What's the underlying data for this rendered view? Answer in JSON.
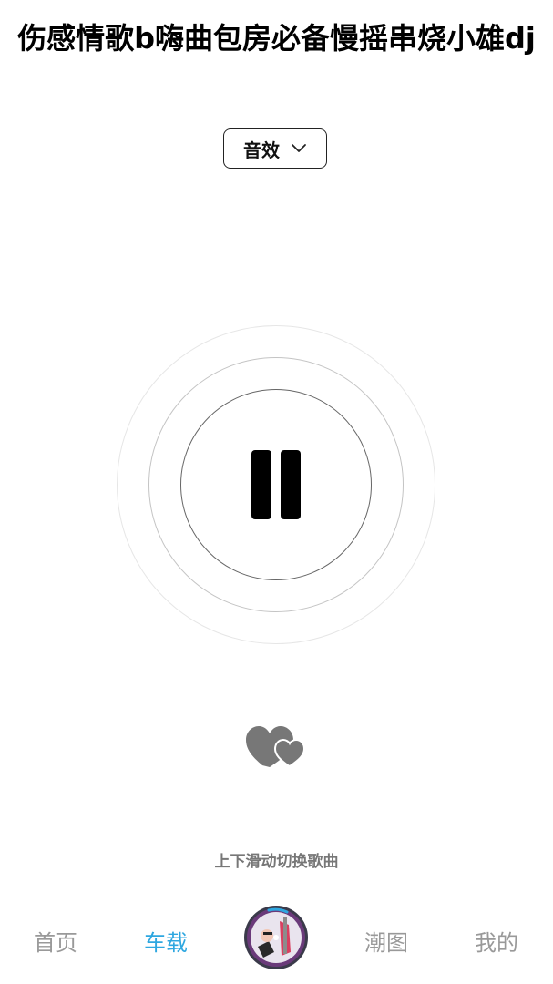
{
  "song": {
    "title": "伤感情歌b嗨曲包房必备慢摇串烧小雄dj"
  },
  "effect_button": {
    "label": "音效",
    "icon": "chevron-down-icon"
  },
  "player": {
    "state": "playing",
    "control_icon": "pause-icon"
  },
  "favorite": {
    "icon": "double-heart-icon",
    "color": "#777777"
  },
  "hint": "上下滑动切换歌曲",
  "tabbar": {
    "items": [
      {
        "label": "首页",
        "active": false
      },
      {
        "label": "车载",
        "active": true
      },
      {
        "label": "",
        "icon": "album-disc"
      },
      {
        "label": "潮图",
        "active": false
      },
      {
        "label": "我的",
        "active": false
      }
    ],
    "active_color": "#2ea7e0",
    "inactive_color": "#999999"
  }
}
